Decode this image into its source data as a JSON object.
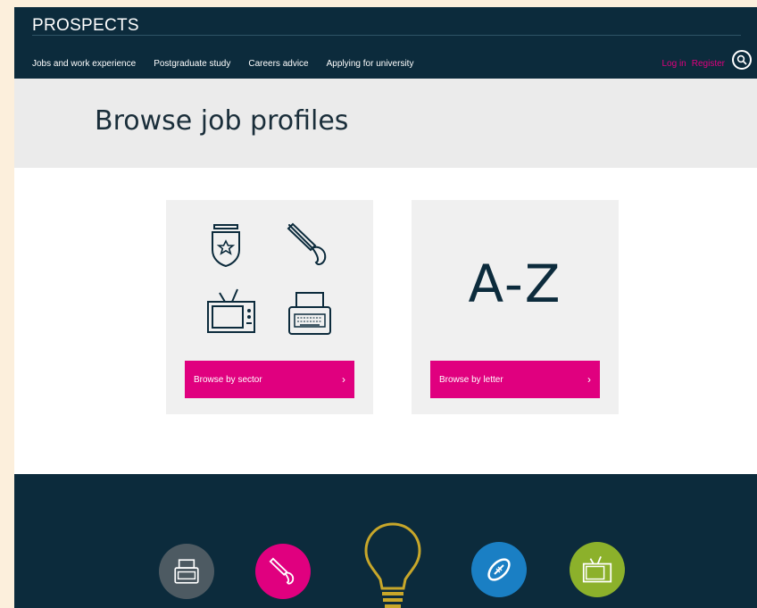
{
  "header": {
    "logo": "PROSPECTS",
    "nav": [
      "Jobs and work experience",
      "Postgraduate study",
      "Careers advice",
      "Applying for university"
    ],
    "login_label": "Log in",
    "register_label": "Register"
  },
  "hero": {
    "title": "Browse job profiles"
  },
  "cards": {
    "sector": {
      "button_label": "Browse by sector",
      "chevron": "›"
    },
    "letter": {
      "heading": "A-Z",
      "button_label": "Browse by letter",
      "chevron": "›"
    }
  },
  "colors": {
    "navy": "#0c2b3c",
    "pink": "#e0007f",
    "grey_card": "#f0f0f0",
    "blue": "#1a7fc4",
    "green": "#8cb12b",
    "gold": "#c8a72a"
  },
  "icons": {
    "sector_card": [
      "police-badge-icon",
      "paintbrush-icon",
      "television-icon",
      "printer-icon"
    ],
    "footer": [
      "printer-icon",
      "paintbrush-icon",
      "lightbulb-icon",
      "rugby-ball-icon",
      "television-icon"
    ]
  }
}
